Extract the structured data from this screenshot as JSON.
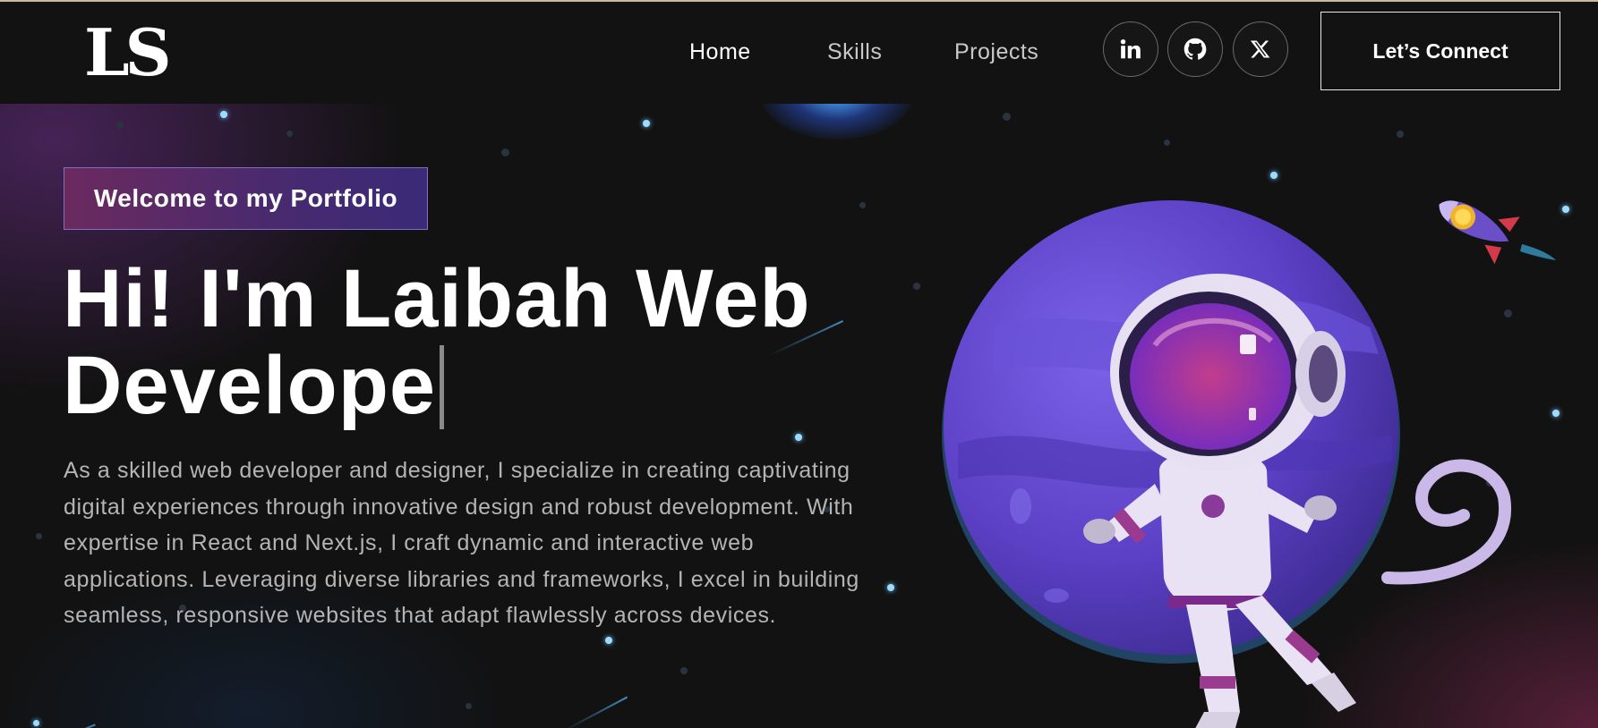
{
  "navbar": {
    "logo": "LS",
    "links": [
      {
        "label": "Home",
        "active": true
      },
      {
        "label": "Skills",
        "active": false
      },
      {
        "label": "Projects",
        "active": false
      }
    ],
    "social": [
      {
        "icon": "linkedin-icon"
      },
      {
        "icon": "github-icon"
      },
      {
        "icon": "x-icon"
      }
    ],
    "cta_label": "Let’s Connect"
  },
  "hero": {
    "badge": "Welcome to my Portfolio",
    "headline": "Hi! I'm Laibah Web Develope",
    "description": "As a skilled web developer and designer, I specialize in creating captivating digital experiences through innovative design and robust development. With expertise in React and Next.js, I craft dynamic and interactive web applications. Leveraging diverse libraries and frameworks, I excel in building seamless, responsive websites that adapt flawlessly across devices.",
    "illustration": "astronaut-planet-illustration",
    "rocket": "rocket-icon"
  },
  "colors": {
    "background": "#121212",
    "badge_gradient_start": "#6b2a5e",
    "badge_gradient_end": "#3a2a78",
    "planet": "#5b3fc4",
    "star": "#9ddcff",
    "text_muted": "#b4b4b4"
  }
}
